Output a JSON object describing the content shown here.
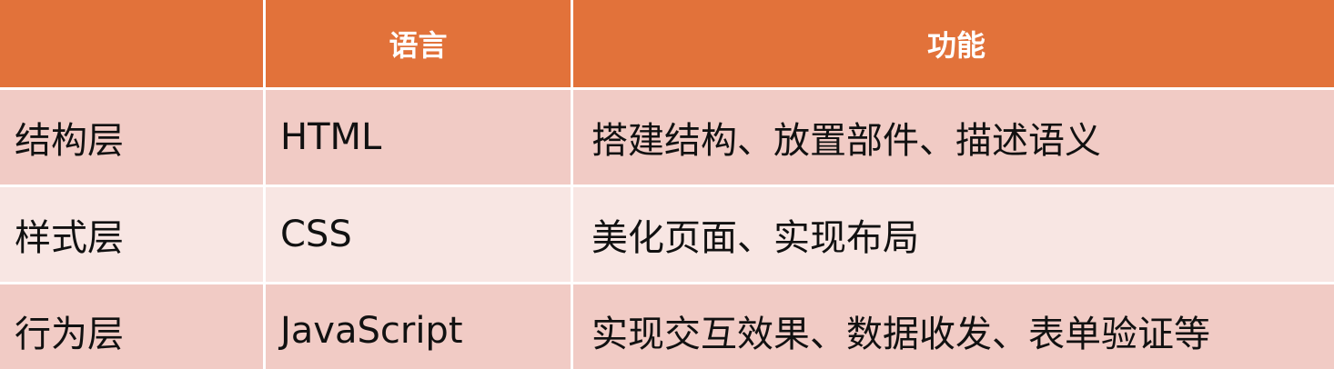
{
  "header": {
    "col1": "",
    "col2": "语言",
    "col3": "功能"
  },
  "rows": [
    {
      "layer": "结构层",
      "language": "HTML",
      "function": "搭建结构、放置部件、描述语义"
    },
    {
      "layer": "样式层",
      "language": "CSS",
      "function": "美化页面、实现布局"
    },
    {
      "layer": "行为层",
      "language": "JavaScript",
      "function": "实现交互效果、数据收发、表单验证等"
    }
  ],
  "colors": {
    "header_bg": "#e2723a",
    "row_dark": "#f1cbc5",
    "row_light": "#f8e6e3"
  }
}
